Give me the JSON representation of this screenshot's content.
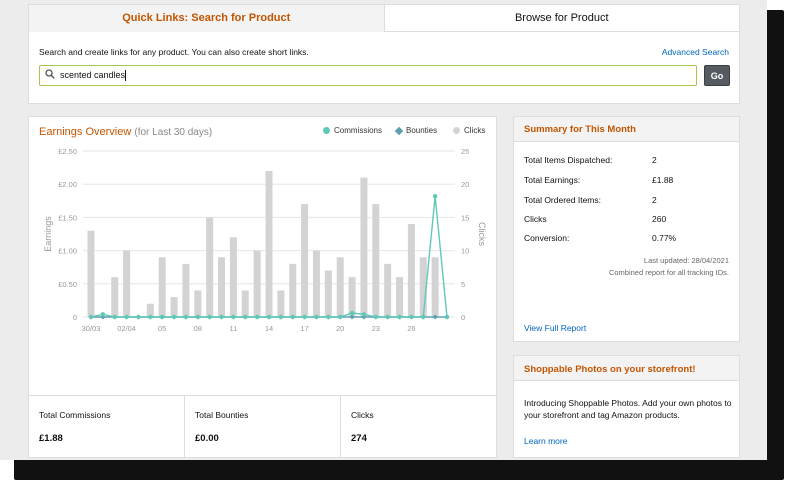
{
  "quick_links": {
    "tab_search": "Quick Links: Search for Product",
    "tab_browse": "Browse for Product",
    "description": "Search and create links for any product. You can also create short links.",
    "advanced_search": "Advanced Search",
    "search_value": "scented candles",
    "go_label": "Go"
  },
  "earnings": {
    "title": "Earnings Overview",
    "subtitle": "(for Last 30 days)",
    "legend_commissions": "Commissions",
    "legend_bounties": "Bounties",
    "legend_clicks": "Clicks",
    "totals": [
      {
        "label": "Total Commissions",
        "value": "£1.88"
      },
      {
        "label": "Total Bounties",
        "value": "£0.00"
      },
      {
        "label": "Clicks",
        "value": "274"
      }
    ]
  },
  "chart_data": {
    "type": "bar",
    "ylabel": "Earnings",
    "y2label": "Clicks",
    "y_ticks": [
      "£2.50",
      "£2.00",
      "£1.50",
      "£1.00",
      "£0.50",
      "0"
    ],
    "y2_ticks": [
      "25",
      "20",
      "15",
      "10",
      "5",
      "0"
    ],
    "ylim": [
      0,
      2.5
    ],
    "y2lim": [
      0,
      25
    ],
    "x_tick_labels": [
      "30/03",
      "02/04",
      "05",
      "08",
      "11",
      "14",
      "17",
      "20",
      "23",
      "26"
    ],
    "x_tick_positions": [
      0,
      3,
      6,
      9,
      12,
      15,
      18,
      21,
      24,
      27
    ],
    "days": 31,
    "series": [
      {
        "name": "Clicks",
        "kind": "bar",
        "axis": "y2",
        "color": "#d3d3d3",
        "values": [
          13,
          0,
          6,
          10,
          0,
          2,
          9,
          3,
          8,
          4,
          15,
          9,
          12,
          4,
          10,
          22,
          4,
          8,
          17,
          10,
          7,
          9,
          6,
          21,
          17,
          8,
          6,
          14,
          9,
          9,
          0
        ]
      },
      {
        "name": "Commissions",
        "kind": "line",
        "axis": "y",
        "color": "#5fc8b7",
        "values": [
          0,
          0.04,
          0,
          0,
          0,
          0,
          0,
          0,
          0,
          0,
          0,
          0,
          0,
          0,
          0,
          0,
          0,
          0,
          0,
          0,
          0,
          0,
          0.06,
          0.04,
          0,
          0,
          0,
          0,
          0,
          1.82,
          0
        ]
      },
      {
        "name": "Bounties",
        "kind": "line",
        "axis": "y",
        "color": "#5e9fb0",
        "values": [
          0,
          0,
          0,
          0,
          0,
          0,
          0,
          0,
          0,
          0,
          0,
          0,
          0,
          0,
          0,
          0,
          0,
          0,
          0,
          0,
          0,
          0,
          0,
          0,
          0,
          0,
          0,
          0,
          0,
          0,
          0
        ]
      }
    ]
  },
  "summary": {
    "title": "Summary for This Month",
    "rows": [
      {
        "label": "Total Items Dispatched:",
        "value": "2"
      },
      {
        "label": "Total Earnings:",
        "value": "£1.88"
      },
      {
        "label": "Total Ordered Items:",
        "value": "2"
      },
      {
        "label": "Clicks",
        "value": "260"
      },
      {
        "label": "Conversion:",
        "value": "0.77%"
      }
    ],
    "last_updated": "Last updated: 28/04/2021",
    "combined": "Combined report for all tracking IDs.",
    "full_report": "View Full Report"
  },
  "shoppable": {
    "title": "Shoppable Photos on your storefront!",
    "description": "Introducing Shoppable Photos. Add your own photos to your storefront and tag Amazon products.",
    "learn_more": "Learn more"
  },
  "colors": {
    "accent": "#c45500",
    "link": "#0066c0",
    "commission_line": "#5fc8b7",
    "bounty_line": "#5e9fb0",
    "bar": "#d3d3d3"
  }
}
